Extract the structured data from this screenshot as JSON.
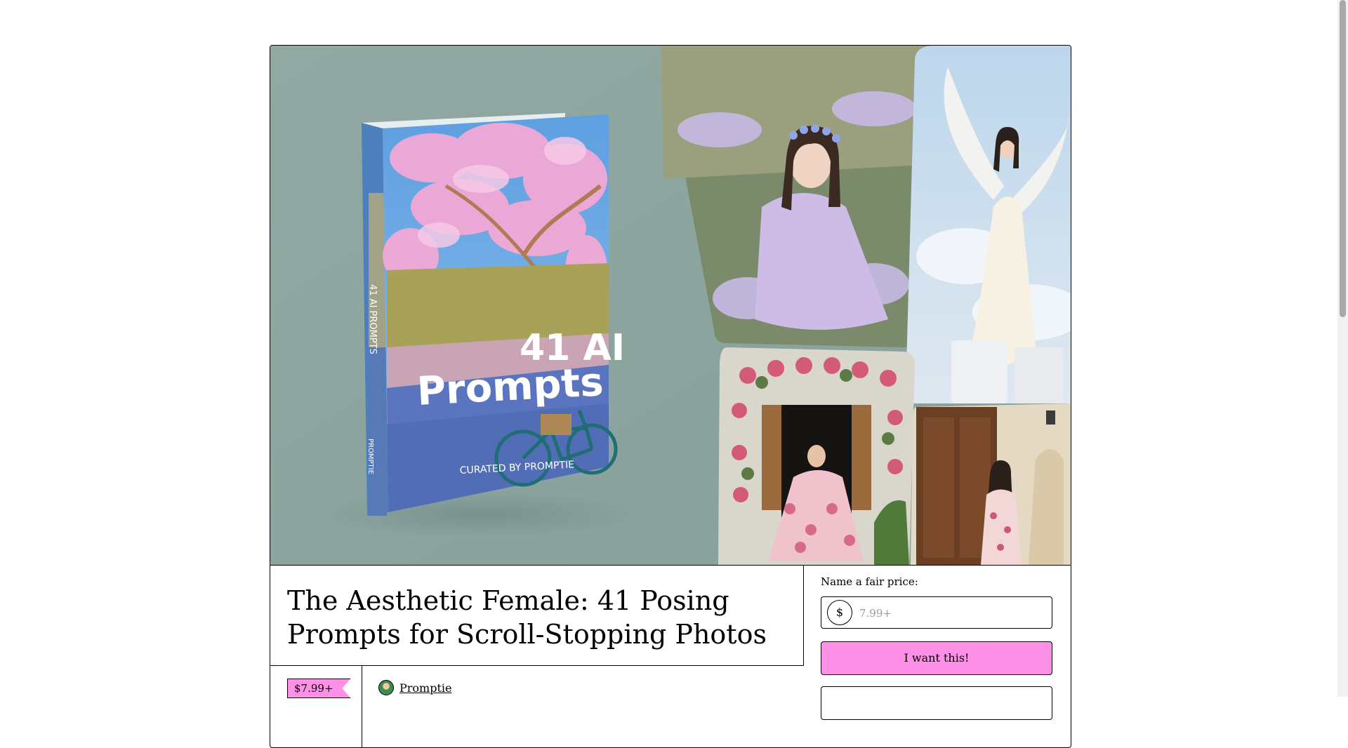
{
  "product": {
    "title": "The Aesthetic Female: 41 Posing Prompts for Scroll-Stopping Photos",
    "price_tag": "$7.99+",
    "creator_name": "Promptie"
  },
  "cover": {
    "title_line1": "41 AI",
    "title_line2": "Prompts",
    "subtitle": "CURATED BY PROMPTIE",
    "spine_text": "41 AI PROMPTS",
    "spine_footer": "PROMPTIE"
  },
  "purchase": {
    "price_label": "Name a fair price:",
    "currency_symbol": "$",
    "price_placeholder": "7.99+",
    "price_value": "",
    "buy_button": "I want this!"
  },
  "colors": {
    "accent": "#ff90e8",
    "hero_background": "#8fa6a1",
    "border": "#000000"
  }
}
